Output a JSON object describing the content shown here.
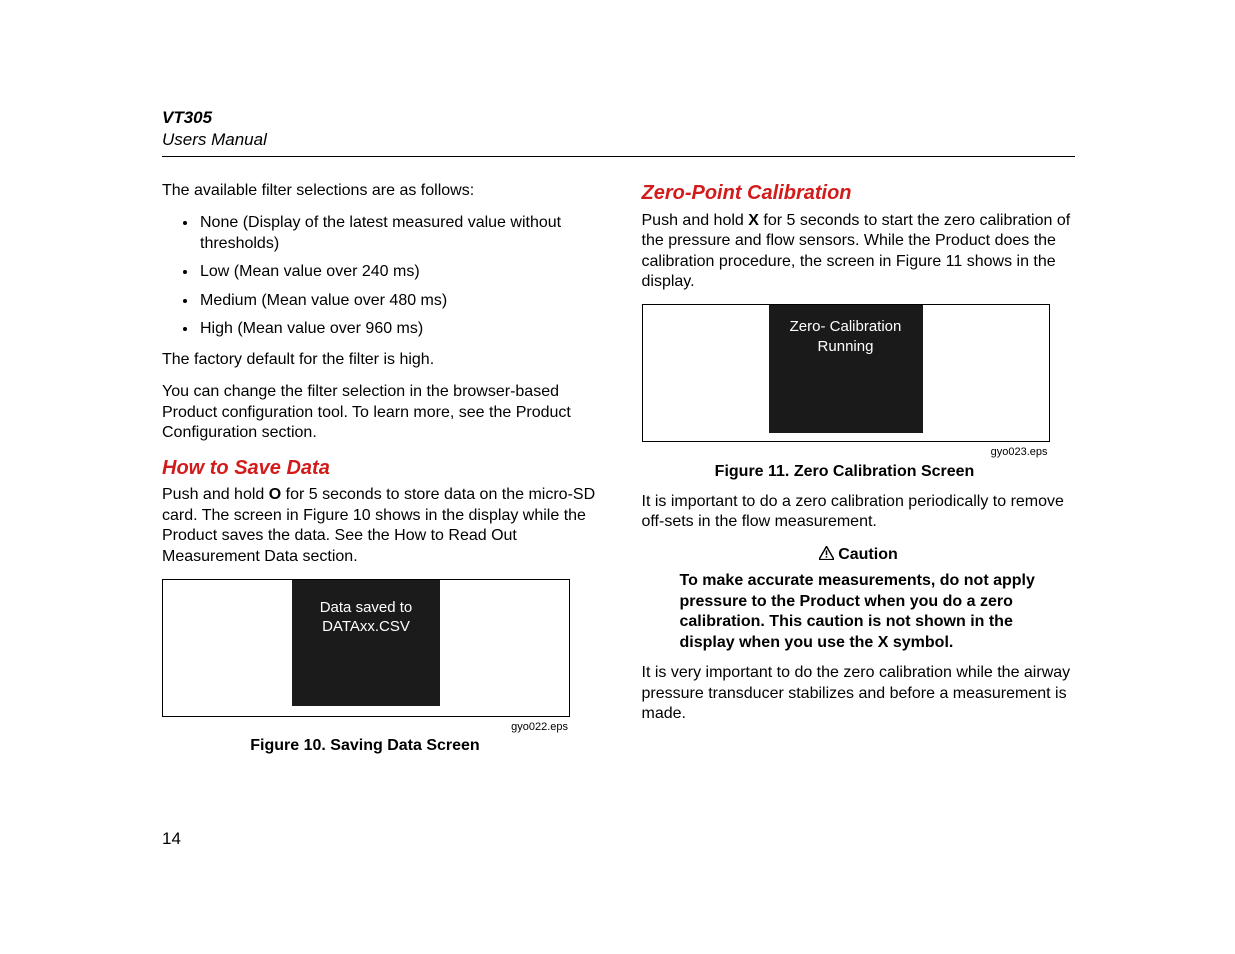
{
  "header": {
    "title": "VT305",
    "subtitle": "Users Manual"
  },
  "left": {
    "intro": "The available filter selections are as follows:",
    "bullets": [
      "None (Display of the latest measured value without thresholds)",
      "Low (Mean value over 240 ms)",
      "Medium (Mean value over 480 ms)",
      "High (Mean value over 960 ms)"
    ],
    "factory": "The factory default for the filter is high.",
    "change": "You can change the filter selection in the browser-based Product configuration tool. To learn more, see the Product Configuration section.",
    "save_head": "How to Save Data",
    "save_p_pre": "Push and hold ",
    "save_p_key": "O",
    "save_p_post": " for 5 seconds to store data on the micro-SD card. The screen in Figure 10 shows in the display while the Product saves the data. See the How to Read Out Measurement Data section.",
    "screen_l1": "Data saved to",
    "screen_l2": "DATAxx.CSV",
    "eps": "gyo022.eps",
    "figcap": "Figure 10. Saving Data Screen"
  },
  "right": {
    "zero_head": "Zero-Point Calibration",
    "zero_p_pre": "Push and hold ",
    "zero_p_key": "X",
    "zero_p_post": " for 5 seconds to start the zero calibration of the pressure and flow sensors. While the Product does the calibration procedure, the screen in Figure 11 shows in the display.",
    "screen_l1": "Zero- Calibration",
    "screen_l2": "Running",
    "eps": "gyo023.eps",
    "figcap": "Figure 11. Zero Calibration Screen",
    "important": "It is important to do a zero calibration periodically to remove off-sets in the flow measurement.",
    "caution_label": "Caution",
    "caution_body": "To make accurate measurements, do not apply pressure to the Product when you do a zero calibration. This caution is not shown in the display when you use the X symbol.",
    "very_important": "It is very important to do the zero calibration while the airway pressure transducer stabilizes and before a measurement is made."
  },
  "page_number": "14"
}
